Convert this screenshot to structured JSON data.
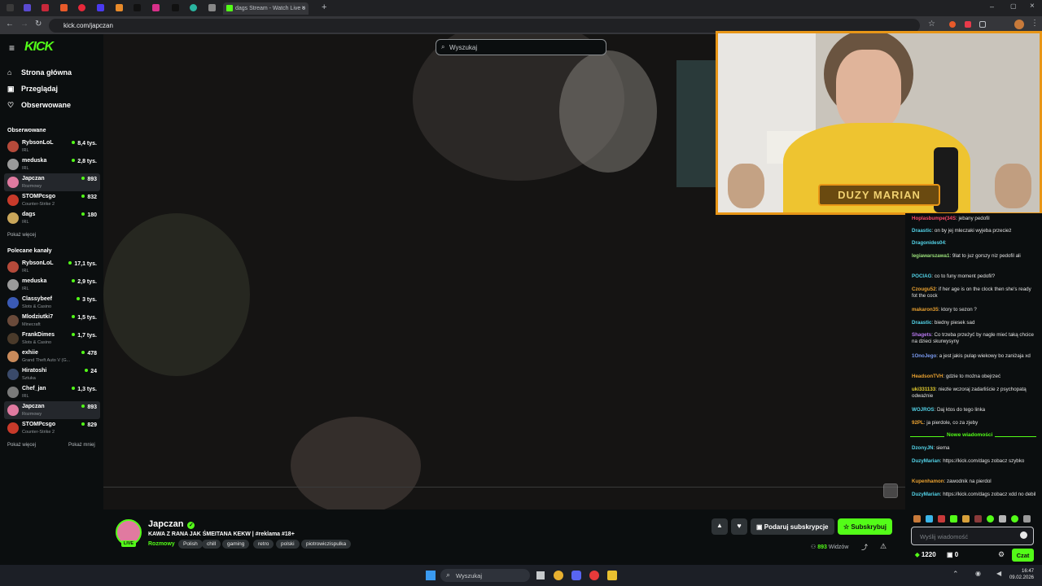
{
  "browser": {
    "tab_title": "dags Stream - Watch Live o",
    "url": "kick.com/japczan"
  },
  "sidebar": {
    "nav": [
      {
        "label": "Strona główna"
      },
      {
        "label": "Przeglądaj"
      },
      {
        "label": "Obserwowane"
      }
    ],
    "followed_title": "Obserwowane",
    "followed": [
      {
        "name": "RybsonLoL",
        "cat": "IRL",
        "viewers": "8,4 tys.",
        "color": "#b54a3a"
      },
      {
        "name": "meduska",
        "cat": "IRL",
        "viewers": "2,8 tys.",
        "color": "#9a9a9a"
      },
      {
        "name": "Japczan",
        "cat": "Rozmowy",
        "viewers": "893",
        "color": "#e07aa0"
      },
      {
        "name": "STOMPcsgo",
        "cat": "Counter-Strike 2",
        "viewers": "832",
        "color": "#c83a2a"
      },
      {
        "name": "dags",
        "cat": "IRL",
        "viewers": "180",
        "color": "#c9a65a"
      }
    ],
    "show_more": "Pokaż więcej",
    "recommended_title": "Polecane kanały",
    "recommended": [
      {
        "name": "RybsonLoL",
        "cat": "IRL",
        "viewers": "17,1 tys.",
        "color": "#b54a3a"
      },
      {
        "name": "meduska",
        "cat": "IRL",
        "viewers": "2,9 tys.",
        "color": "#9a9a9a"
      },
      {
        "name": "Classybeef",
        "cat": "Slots & Casino",
        "viewers": "3 tys.",
        "color": "#3a5ab5"
      },
      {
        "name": "Mlodziutki7",
        "cat": "Minecraft",
        "viewers": "1,5 tys.",
        "color": "#6a4a3a"
      },
      {
        "name": "FrankDimes",
        "cat": "Slots & Casino",
        "viewers": "1,7 tys.",
        "color": "#4a3a2a"
      },
      {
        "name": "exhiie",
        "cat": "Grand Theft Auto V (G...",
        "viewers": "478",
        "color": "#c98a5a"
      },
      {
        "name": "Hiratoshi",
        "cat": "Sztuka",
        "viewers": "24",
        "color": "#3a4a6a"
      },
      {
        "name": "Chef_jan",
        "cat": "IRL",
        "viewers": "1,3 tys.",
        "color": "#7a7a7a"
      },
      {
        "name": "Japczan",
        "cat": "Rozmowy",
        "viewers": "893",
        "color": "#e07aa0"
      },
      {
        "name": "STOMPcsgo",
        "cat": "Counter-Strike 2",
        "viewers": "829",
        "color": "#c83a2a"
      }
    ],
    "show_more2": "Pokaż więcej",
    "show_less": "Pokaż mniej"
  },
  "header": {
    "logo": "KICK",
    "search_placeholder": "Wyszukaj"
  },
  "overlay": {
    "banner": "DUZY MARIAN"
  },
  "stream": {
    "channel": "Japczan",
    "title": "KAWA Z RANA JAK ŚMEITANA KEKW | #reklama #18+",
    "category": "Rozmowy",
    "tags": [
      "Polish",
      "chill",
      "gaming",
      "retro",
      "polski",
      "piotrowiczispulka"
    ],
    "live": "LIVE",
    "viewers": "893",
    "viewers_label": "Widzów",
    "gift_sub": "Podaruj subskrypcje",
    "subscribe": "Subskrybuj"
  },
  "chat": {
    "messages": [
      {
        "user": "Hoplasbumpe(34S",
        "text": "jebany pedofil",
        "color": "#ff4a6a"
      },
      {
        "user": "Draastic",
        "text": "on by jej mleczaki wyjeba przecież",
        "color": "#53d3e8"
      },
      {
        "user": "Dragonides04",
        "text": "",
        "color": "#53d3e8"
      },
      {
        "user": "legiawarszawa1",
        "text": "9lat to juz gorszy niz pedofil ali",
        "color": "#9ae07a"
      },
      {
        "user": "POCIAG",
        "text": "co to funy moment pedofil?",
        "color": "#53d3e8"
      },
      {
        "user": "Czougu52",
        "text": "if her age is on the clock then she's ready fot the cock",
        "color": "#e8a030"
      },
      {
        "user": "makaron35",
        "text": "ktory to sezon ?",
        "color": "#e8a030"
      },
      {
        "user": "Draastic",
        "text": "biedny piesek sad",
        "color": "#53d3e8"
      },
      {
        "user": "Shagets",
        "text": "Co trzeba przeżyć by nagle mieć taką chcice na dzieci skurwysyny",
        "color": "#b878f0"
      },
      {
        "user": "1OnoJego",
        "text": "a jest jakis pulap wiekowy bo zaniżaja xd",
        "color": "#7a9af0"
      },
      {
        "user": "HeadsonTVH",
        "text": "gdzie to można obejrzeć",
        "color": "#e8a030"
      },
      {
        "user": "uki331133",
        "text": "niezle wczoraj zadarliście z psychopatą odważnie",
        "color": "#e8d030"
      },
      {
        "user": "WOJROS",
        "text": "Daj ktos do tego linka",
        "color": "#53d3e8"
      },
      {
        "user": "92PL",
        "text": "ja pierdole, co za zjeby",
        "color": "#e8a030"
      }
    ],
    "new_messages": "Nowe wiadomości",
    "messages2": [
      {
        "user": "DzonyJN",
        "text": "siema",
        "color": "#53d3e8"
      },
      {
        "user": "DuzyMarian",
        "text": "https://kick.com/dags zobacz szybko",
        "color": "#53d3e8"
      },
      {
        "user": "Kupenhamon",
        "text": "zawodnik na pierdol",
        "color": "#e8a030"
      },
      {
        "user": "DuzyMarian",
        "text": "https://kick.com/dags zobacz xdd no debil",
        "color": "#53d3e8"
      }
    ],
    "input_placeholder": "Wyślij wiadomość",
    "points": "1220",
    "gifts": "0",
    "send": "Czat"
  },
  "taskbar": {
    "search": "Wyszukaj",
    "time": "16:47",
    "date": "09.02.2026"
  }
}
